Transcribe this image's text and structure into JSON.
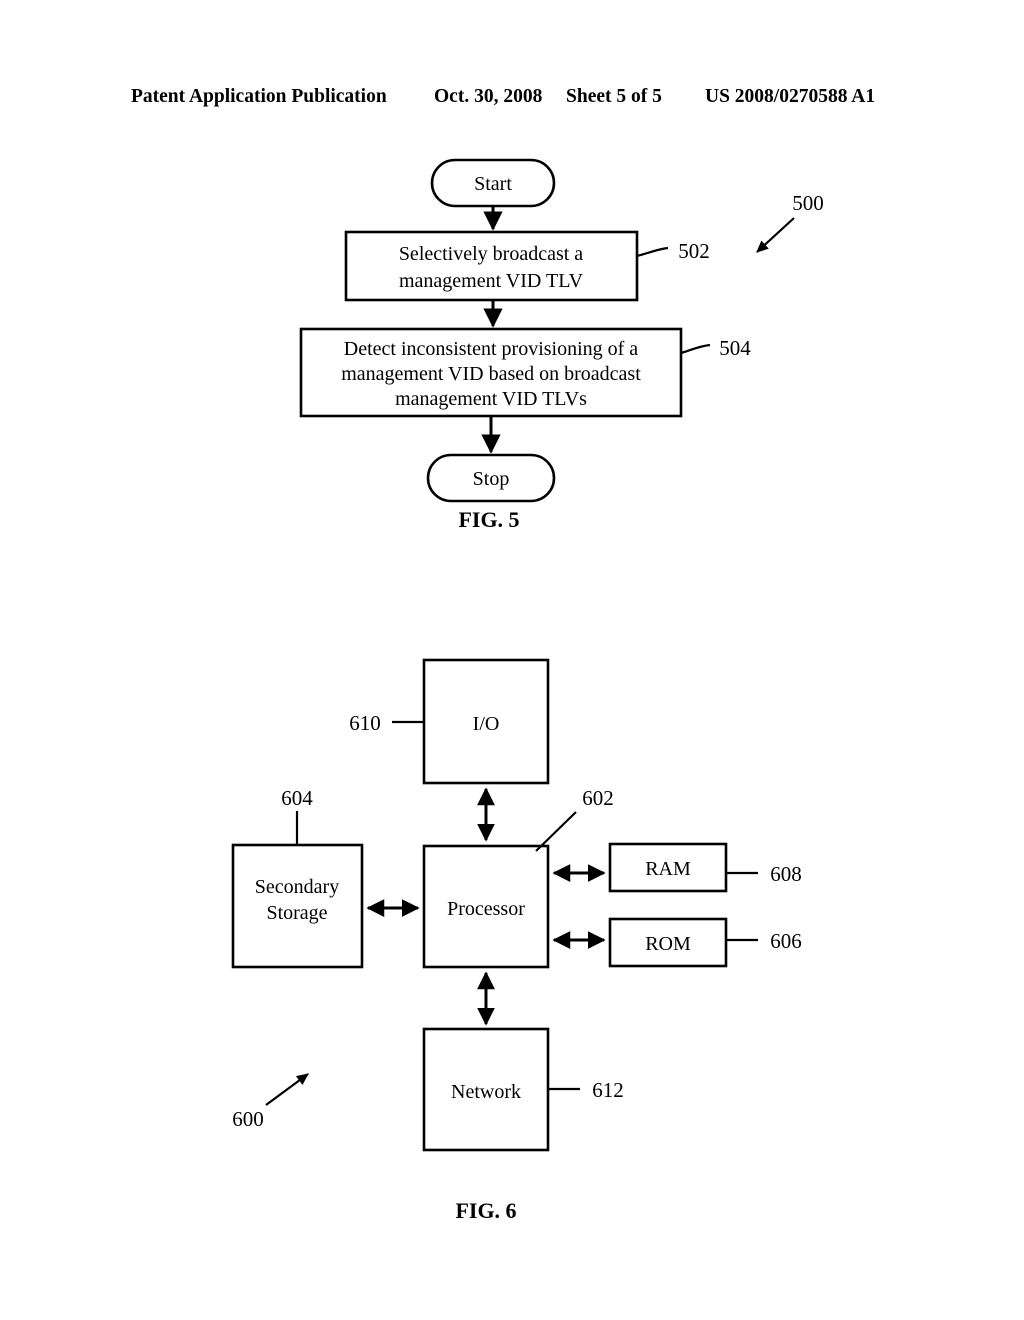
{
  "header": {
    "publication": "Patent Application Publication",
    "date": "Oct. 30, 2008",
    "sheet": "Sheet 5 of 5",
    "patent_number": "US 2008/0270588 A1"
  },
  "figures": [
    {
      "caption": "FIG. 5",
      "figure_ref": "500",
      "type": "flowchart",
      "nodes": [
        {
          "id": "start",
          "shape": "terminator",
          "label": "Start",
          "ref": ""
        },
        {
          "id": "step502",
          "shape": "process",
          "label_lines": [
            "Selectively broadcast a",
            "management VID TLV"
          ],
          "ref": "502"
        },
        {
          "id": "step504",
          "shape": "process",
          "label_lines": [
            "Detect inconsistent provisioning of a",
            "management VID based on broadcast",
            "management VID TLVs"
          ],
          "ref": "504"
        },
        {
          "id": "stop",
          "shape": "terminator",
          "label": "Stop",
          "ref": ""
        }
      ],
      "edges": [
        {
          "from": "start",
          "to": "step502",
          "style": "arrow"
        },
        {
          "from": "step502",
          "to": "step504",
          "style": "arrow"
        },
        {
          "from": "step504",
          "to": "stop",
          "style": "arrow"
        }
      ]
    },
    {
      "caption": "FIG. 6",
      "figure_ref": "600",
      "type": "block-diagram",
      "nodes": [
        {
          "id": "io",
          "label": "I/O",
          "ref": "610"
        },
        {
          "id": "secondary",
          "label_lines": [
            "Secondary",
            "Storage"
          ],
          "ref": "604"
        },
        {
          "id": "processor",
          "label": "Processor",
          "ref": "602"
        },
        {
          "id": "ram",
          "label": "RAM",
          "ref": "608"
        },
        {
          "id": "rom",
          "label": "ROM",
          "ref": "606"
        },
        {
          "id": "network",
          "label": "Network",
          "ref": "612"
        }
      ],
      "edges": [
        {
          "from": "io",
          "to": "processor",
          "style": "double-arrow"
        },
        {
          "from": "secondary",
          "to": "processor",
          "style": "double-arrow"
        },
        {
          "from": "processor",
          "to": "ram",
          "style": "double-arrow"
        },
        {
          "from": "processor",
          "to": "rom",
          "style": "double-arrow"
        },
        {
          "from": "processor",
          "to": "network",
          "style": "double-arrow"
        }
      ]
    }
  ],
  "colors": {
    "ink": "#000000",
    "paper": "#ffffff"
  }
}
